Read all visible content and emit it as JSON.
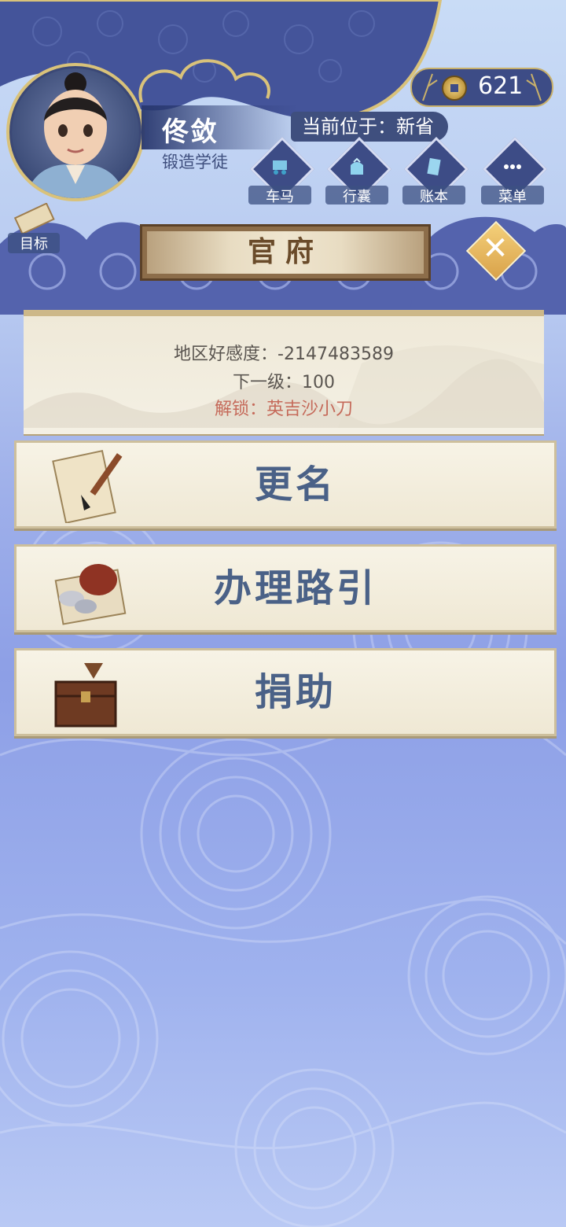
{
  "player": {
    "name": "佟敛",
    "title": "锻造学徒"
  },
  "location": "当前位于：新省",
  "currency": {
    "value": "621",
    "icon": "coin-icon"
  },
  "nav": [
    {
      "label": "车马",
      "icon": "carriage-icon"
    },
    {
      "label": "行囊",
      "icon": "bag-icon"
    },
    {
      "label": "账本",
      "icon": "ledger-icon"
    },
    {
      "label": "菜单",
      "icon": "menu-dots-icon"
    }
  ],
  "goal": {
    "label": "目标",
    "icon": "scroll-icon"
  },
  "header": {
    "title": "官府"
  },
  "info": {
    "favor": "地区好感度：-2147483589",
    "next_level": "下一级：100",
    "unlock": "解锁：英吉沙小刀"
  },
  "actions": [
    {
      "label": "更名",
      "icon": "rename-paper-brush-icon"
    },
    {
      "label": "办理路引",
      "icon": "silver-pouch-pass-icon"
    },
    {
      "label": "捐助",
      "icon": "treasure-chest-icon"
    }
  ],
  "colors": {
    "banner": "#3d4c86",
    "gold": "#d9c27a",
    "card_text": "#4a6187",
    "unlock_text": "#c56a5a"
  }
}
